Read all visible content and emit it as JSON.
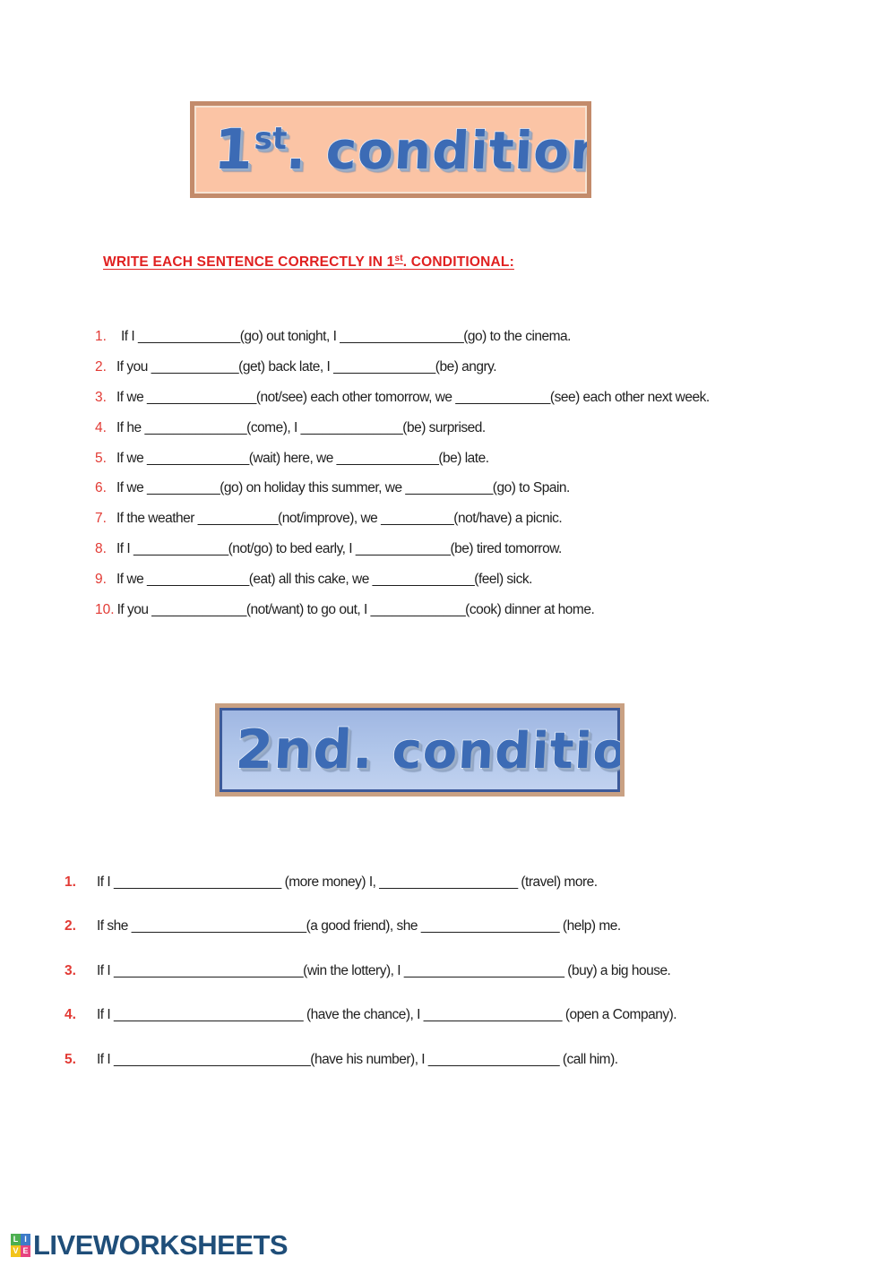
{
  "page": {
    "background_color": "#ffffff",
    "accent_red": "#E23A34",
    "accent_blue": "#3C6BB5",
    "logo_navy": "#1F4E79"
  },
  "banner_1": {
    "prefix": "1",
    "superscript": "st",
    "rest": ". conditional",
    "fill_color": "#FBC4A5",
    "border_color": "#C38B6B"
  },
  "banner_2": {
    "text": "2nd.",
    "rest": " conditional",
    "fill_color": "#AEC4E9",
    "border_color": "#C9A183"
  },
  "instruction": {
    "before": "WRITE EACH SENTENCE CORRECTLY IN 1",
    "superscript": "st",
    "after": ".  CONDITIONAL:"
  },
  "section_1": {
    "items": [
      {
        "number": "1.",
        "text": "If I ______________(go) out tonight, I _________________(go) to the cinema."
      },
      {
        "number": "2.",
        "text": "If you ____________(get) back late, I ______________(be) angry."
      },
      {
        "number": "3.",
        "text": "If we _______________(not/see) each other tomorrow, we _____________(see) each other next week."
      },
      {
        "number": "4.",
        "text": "If he ______________(come), I ______________(be) surprised."
      },
      {
        "number": "5.",
        "text": "If we ______________(wait) here, we ______________(be) late."
      },
      {
        "number": "6.",
        "text": "If we __________(go) on holiday this summer, we ____________(go) to Spain."
      },
      {
        "number": "7.",
        "text": "If the weather ___________(not/improve), we __________(not/have) a picnic."
      },
      {
        "number": "8.",
        "text": "If I _____________(not/go) to bed early, I _____________(be) tired tomorrow."
      },
      {
        "number": "9.",
        "text": "If we ______________(eat) all this cake, we ______________(feel) sick."
      },
      {
        "number": "10.",
        "text": "If you _____________(not/want) to go out, I _____________(cook) dinner at home."
      }
    ]
  },
  "section_2": {
    "items": [
      {
        "number": "1.",
        "text": "If I _______________________ (more money) I, ___________________ (travel) more."
      },
      {
        "number": "2.",
        "text": "If she ________________________(a good friend), she ___________________ (help) me."
      },
      {
        "number": "3.",
        "text": "If I __________________________(win the lottery), I ______________________ (buy) a big house."
      },
      {
        "number": "4.",
        "text": "If I __________________________ (have the chance), I ___________________ (open a Company)."
      },
      {
        "number": "5.",
        "text": "If I ___________________________(have his number), I __________________ (call him)."
      }
    ]
  },
  "footer": {
    "tiles": [
      "L",
      "I",
      "V",
      "E"
    ],
    "wordmark": "LIVEWORKSHEETS"
  }
}
